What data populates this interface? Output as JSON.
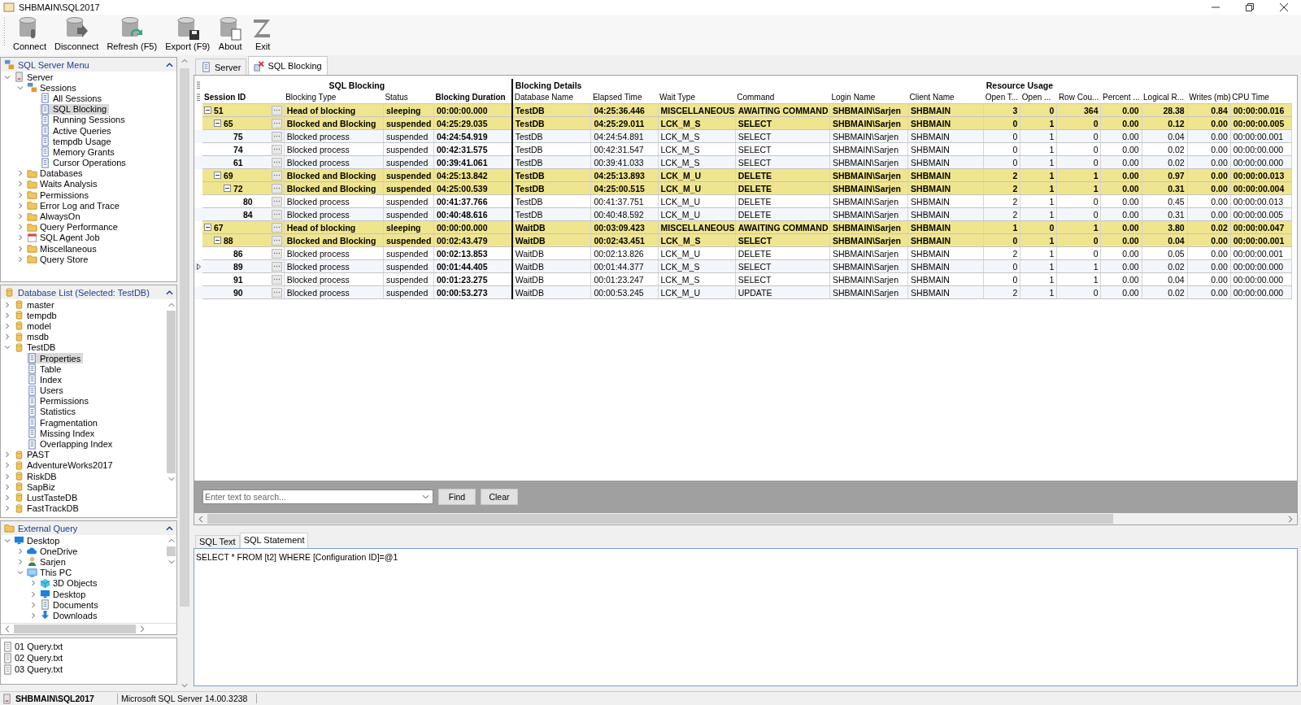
{
  "window": {
    "title": "SHBMAIN\\SQL2017"
  },
  "toolbar": [
    {
      "label": "Connect",
      "kind": "connect"
    },
    {
      "label": "Disconnect",
      "kind": "disconnect"
    },
    {
      "label": "Refresh (F5)",
      "kind": "refresh"
    },
    {
      "label": "Export (F9)",
      "kind": "export"
    },
    {
      "label": "About",
      "kind": "about"
    },
    {
      "label": "Exit",
      "kind": "exit"
    }
  ],
  "sidebar": {
    "panels": [
      {
        "title": "SQL Server Menu",
        "kind": "menu",
        "items": [
          {
            "label": "Server",
            "kind": "server",
            "expanded": true,
            "selected": false,
            "children": [
              {
                "label": "Sessions",
                "kind": "sessions",
                "expanded": true,
                "selected": false,
                "children": [
                  {
                    "label": "All Sessions",
                    "kind": "page",
                    "selected": false
                  },
                  {
                    "label": "SQL Blocking",
                    "kind": "page",
                    "selected": true
                  },
                  {
                    "label": "Running Sessions",
                    "kind": "page",
                    "selected": false
                  },
                  {
                    "label": "Active Queries",
                    "kind": "page",
                    "selected": false
                  },
                  {
                    "label": "tempdb Usage",
                    "kind": "page",
                    "selected": false
                  },
                  {
                    "label": "Memory Grants",
                    "kind": "page",
                    "selected": false
                  },
                  {
                    "label": "Cursor Operations",
                    "kind": "page",
                    "selected": false
                  }
                ]
              },
              {
                "label": "Databases",
                "kind": "folder",
                "expanded": false,
                "selected": false
              },
              {
                "label": "Waits Analysis",
                "kind": "folder",
                "expanded": false,
                "selected": false
              },
              {
                "label": "Permissions",
                "kind": "folder",
                "expanded": false,
                "selected": false
              },
              {
                "label": "Error Log and Trace",
                "kind": "folder",
                "expanded": false,
                "selected": false
              },
              {
                "label": "AlwaysOn",
                "kind": "folder",
                "expanded": false,
                "selected": false
              },
              {
                "label": "Query Performance",
                "kind": "folder",
                "expanded": false,
                "selected": false
              },
              {
                "label": "SQL Agent Job",
                "kind": "calendar",
                "expanded": false,
                "selected": false
              },
              {
                "label": "Miscellaneous",
                "kind": "folder",
                "expanded": false,
                "selected": false
              },
              {
                "label": "Query Store",
                "kind": "folder",
                "expanded": false,
                "selected": false
              }
            ]
          }
        ]
      },
      {
        "title": "Database List (Selected: TestDB)",
        "kind": "list",
        "items": [
          {
            "label": "master",
            "kind": "db",
            "expanded": false,
            "selected": false
          },
          {
            "label": "tempdb",
            "kind": "db",
            "expanded": false,
            "selected": false
          },
          {
            "label": "model",
            "kind": "db",
            "expanded": false,
            "selected": false
          },
          {
            "label": "msdb",
            "kind": "db",
            "expanded": false,
            "selected": false
          },
          {
            "label": "TestDB",
            "kind": "db",
            "expanded": true,
            "selected": false,
            "children": [
              {
                "label": "Properties",
                "kind": "page",
                "selected": true
              },
              {
                "label": "Table",
                "kind": "page",
                "selected": false
              },
              {
                "label": "Index",
                "kind": "page",
                "selected": false
              },
              {
                "label": "Users",
                "kind": "page",
                "selected": false
              },
              {
                "label": "Permissions",
                "kind": "page",
                "selected": false
              },
              {
                "label": "Statistics",
                "kind": "page",
                "selected": false
              },
              {
                "label": "Fragmentation",
                "kind": "page",
                "selected": false
              },
              {
                "label": "Missing Index",
                "kind": "page",
                "selected": false
              },
              {
                "label": "Overlapping Index",
                "kind": "page",
                "selected": false
              }
            ]
          },
          {
            "label": "PAST",
            "kind": "db",
            "expanded": false,
            "selected": false
          },
          {
            "label": "AdventureWorks2017",
            "kind": "db",
            "expanded": false,
            "selected": false
          },
          {
            "label": "RiskDB",
            "kind": "db",
            "expanded": false,
            "selected": false
          },
          {
            "label": "SapBiz",
            "kind": "db",
            "expanded": false,
            "selected": false
          },
          {
            "label": "LustTasteDB",
            "kind": "db",
            "expanded": false,
            "selected": false
          },
          {
            "label": "FastTrackDB",
            "kind": "db",
            "expanded": false,
            "selected": false
          }
        ]
      },
      {
        "title": "External Query",
        "kind": "explorer",
        "items": [
          {
            "label": "Desktop",
            "kind": "desktop",
            "expanded": true,
            "selected": false,
            "children": [
              {
                "label": "OneDrive",
                "kind": "cloud",
                "expanded": false,
                "selected": false
              },
              {
                "label": "Sarjen",
                "kind": "user",
                "expanded": false,
                "selected": false
              },
              {
                "label": "This PC",
                "kind": "pc",
                "expanded": true,
                "selected": false,
                "children": [
                  {
                    "label": "3D Objects",
                    "kind": "cube",
                    "expanded": false,
                    "selected": false
                  },
                  {
                    "label": "Desktop",
                    "kind": "desktop",
                    "expanded": false,
                    "selected": false
                  },
                  {
                    "label": "Documents",
                    "kind": "docs",
                    "expanded": false,
                    "selected": false
                  },
                  {
                    "label": "Downloads",
                    "kind": "download",
                    "expanded": false,
                    "selected": false
                  }
                ]
              }
            ]
          }
        ]
      }
    ],
    "files": [
      "01 Query.txt",
      "02 Query.txt",
      "03 Query.txt"
    ]
  },
  "tabs": [
    {
      "label": "Server",
      "kind": "server",
      "selected": false
    },
    {
      "label": "SQL Blocking",
      "kind": "blocking",
      "selected": true
    }
  ],
  "grid": {
    "column_groups": [
      "SQL Blocking",
      "Blocking Details",
      "Resource Usage"
    ],
    "columns": [
      {
        "label": "Session ID",
        "bold": true
      },
      {
        "label": "Blocking Type",
        "bold": false
      },
      {
        "label": "Status",
        "bold": false
      },
      {
        "label": "Blocking Duration",
        "bold": true
      },
      {
        "label": "Database Name",
        "bold": false
      },
      {
        "label": "Elapsed Time",
        "bold": false
      },
      {
        "label": "Wait Type",
        "bold": false
      },
      {
        "label": "Command",
        "bold": false
      },
      {
        "label": "Login Name",
        "bold": false
      },
      {
        "label": "Client Name",
        "bold": false
      },
      {
        "label": "Open T...",
        "bold": false
      },
      {
        "label": "Open ...",
        "bold": false
      },
      {
        "label": "Row Cou...",
        "bold": false
      },
      {
        "label": "Percent ...",
        "bold": false
      },
      {
        "label": "Logical R...",
        "bold": false
      },
      {
        "label": "Writes (mb)",
        "bold": false
      },
      {
        "label": "CPU Time",
        "bold": false
      }
    ],
    "rows": [
      {
        "kind": "blocking",
        "selected": false,
        "expanded": true,
        "cells": [
          "51",
          "Head of blocking",
          "sleeping",
          "00:00:00.000",
          "TestDB",
          "04:25:36.446",
          "MISCELLANEOUS",
          "AWAITING COMMAND",
          "SHBMAIN\\Sarjen",
          "SHBMAIN",
          "3",
          "0",
          "364",
          "0.00",
          "28.38",
          "0.84",
          "00:00:00.016"
        ],
        "children": [
          {
            "kind": "blocking",
            "selected": false,
            "expanded": true,
            "cells": [
              "65",
              "Blocked and Blocking",
              "suspended",
              "04:25:29.035",
              "TestDB",
              "04:25:29.011",
              "LCK_M_S",
              "SELECT",
              "SHBMAIN\\Sarjen",
              "SHBMAIN",
              "0",
              "1",
              "0",
              "0.00",
              "0.12",
              "0.00",
              "00:00:00.005"
            ],
            "children": [
              {
                "kind": "blocked",
                "selected": false,
                "cells": [
                  "75",
                  "Blocked process",
                  "suspended",
                  "04:24:54.919",
                  "TestDB",
                  "04:24:54.891",
                  "LCK_M_S",
                  "SELECT",
                  "SHBMAIN\\Sarjen",
                  "SHBMAIN",
                  "0",
                  "1",
                  "0",
                  "0.00",
                  "0.04",
                  "0.00",
                  "00:00:00.001"
                ]
              },
              {
                "kind": "blocked",
                "selected": false,
                "cells": [
                  "74",
                  "Blocked process",
                  "suspended",
                  "00:42:31.575",
                  "TestDB",
                  "00:42:31.547",
                  "LCK_M_S",
                  "SELECT",
                  "SHBMAIN\\Sarjen",
                  "SHBMAIN",
                  "0",
                  "1",
                  "0",
                  "0.00",
                  "0.02",
                  "0.00",
                  "00:00:00.000"
                ]
              },
              {
                "kind": "blocked",
                "selected": false,
                "cells": [
                  "61",
                  "Blocked process",
                  "suspended",
                  "00:39:41.061",
                  "TestDB",
                  "00:39:41.033",
                  "LCK_M_S",
                  "SELECT",
                  "SHBMAIN\\Sarjen",
                  "SHBMAIN",
                  "0",
                  "1",
                  "0",
                  "0.00",
                  "0.02",
                  "0.00",
                  "00:00:00.000"
                ]
              }
            ]
          },
          {
            "kind": "blocking",
            "selected": false,
            "expanded": true,
            "cells": [
              "69",
              "Blocked and Blocking",
              "suspended",
              "04:25:13.842",
              "TestDB",
              "04:25:13.893",
              "LCK_M_U",
              "DELETE",
              "SHBMAIN\\Sarjen",
              "SHBMAIN",
              "2",
              "1",
              "1",
              "0.00",
              "0.97",
              "0.00",
              "00:00:00.013"
            ],
            "children": [
              {
                "kind": "blocking",
                "selected": false,
                "expanded": true,
                "cells": [
                  "72",
                  "Blocked and Blocking",
                  "suspended",
                  "04:25:00.539",
                  "TestDB",
                  "04:25:00.515",
                  "LCK_M_U",
                  "DELETE",
                  "SHBMAIN\\Sarjen",
                  "SHBMAIN",
                  "2",
                  "1",
                  "1",
                  "0.00",
                  "0.31",
                  "0.00",
                  "00:00:00.004"
                ],
                "children": [
                  {
                    "kind": "blocked",
                    "selected": false,
                    "cells": [
                      "80",
                      "Blocked process",
                      "suspended",
                      "00:41:37.766",
                      "TestDB",
                      "00:41:37.751",
                      "LCK_M_U",
                      "DELETE",
                      "SHBMAIN\\Sarjen",
                      "SHBMAIN",
                      "2",
                      "1",
                      "0",
                      "0.00",
                      "0.45",
                      "0.00",
                      "00:00:00.013"
                    ]
                  },
                  {
                    "kind": "blocked",
                    "selected": false,
                    "cells": [
                      "84",
                      "Blocked process",
                      "suspended",
                      "00:40:48.616",
                      "TestDB",
                      "00:40:48.592",
                      "LCK_M_U",
                      "DELETE",
                      "SHBMAIN\\Sarjen",
                      "SHBMAIN",
                      "2",
                      "1",
                      "0",
                      "0.00",
                      "0.31",
                      "0.00",
                      "00:00:00.005"
                    ]
                  }
                ]
              }
            ]
          }
        ]
      },
      {
        "kind": "blocking",
        "selected": false,
        "expanded": true,
        "cells": [
          "67",
          "Head of blocking",
          "sleeping",
          "00:00:00.000",
          "WaitDB",
          "00:03:09.423",
          "MISCELLANEOUS",
          "AWAITING COMMAND",
          "SHBMAIN\\Sarjen",
          "SHBMAIN",
          "1",
          "0",
          "1",
          "0.00",
          "3.80",
          "0.02",
          "00:00:00.047"
        ],
        "children": [
          {
            "kind": "blocking",
            "selected": false,
            "expanded": true,
            "cells": [
              "88",
              "Blocked and Blocking",
              "suspended",
              "00:02:43.479",
              "WaitDB",
              "00:02:43.451",
              "LCK_M_S",
              "SELECT",
              "SHBMAIN\\Sarjen",
              "SHBMAIN",
              "0",
              "1",
              "0",
              "0.00",
              "0.04",
              "0.00",
              "00:00:00.001"
            ],
            "children": [
              {
                "kind": "blocked",
                "selected": false,
                "cells": [
                  "86",
                  "Blocked process",
                  "suspended",
                  "00:02:13.853",
                  "WaitDB",
                  "00:02:13.826",
                  "LCK_M_U",
                  "DELETE",
                  "SHBMAIN\\Sarjen",
                  "SHBMAIN",
                  "2",
                  "1",
                  "0",
                  "0.00",
                  "0.05",
                  "0.00",
                  "00:00:00.001"
                ]
              },
              {
                "kind": "blocked",
                "selected": true,
                "cells": [
                  "89",
                  "Blocked process",
                  "suspended",
                  "00:01:44.405",
                  "WaitDB",
                  "00:01:44.377",
                  "LCK_M_S",
                  "SELECT",
                  "SHBMAIN\\Sarjen",
                  "SHBMAIN",
                  "0",
                  "1",
                  "1",
                  "0.00",
                  "0.02",
                  "0.00",
                  "00:00:00.000"
                ]
              },
              {
                "kind": "blocked",
                "selected": false,
                "cells": [
                  "91",
                  "Blocked process",
                  "suspended",
                  "00:01:23.275",
                  "WaitDB",
                  "00:01:23.247",
                  "LCK_M_S",
                  "SELECT",
                  "SHBMAIN\\Sarjen",
                  "SHBMAIN",
                  "0",
                  "1",
                  "1",
                  "0.00",
                  "0.04",
                  "0.00",
                  "00:00:00.000"
                ]
              },
              {
                "kind": "blocked",
                "selected": false,
                "cells": [
                  "90",
                  "Blocked process",
                  "suspended",
                  "00:00:53.273",
                  "WaitDB",
                  "00:00:53.245",
                  "LCK_M_U",
                  "UPDATE",
                  "SHBMAIN\\Sarjen",
                  "SHBMAIN",
                  "2",
                  "1",
                  "0",
                  "0.00",
                  "0.02",
                  "0.00",
                  "00:00:00.000"
                ]
              }
            ]
          }
        ]
      }
    ]
  },
  "search": {
    "placeholder": "Enter text to search...",
    "buttons": [
      "Find",
      "Clear"
    ]
  },
  "bottom_tabs": [
    {
      "label": "SQL Text",
      "selected": false
    },
    {
      "label": "SQL Statement",
      "selected": true
    }
  ],
  "sql_text": "SELECT * FROM [t2] WHERE [Configuration ID]=@1",
  "status_bar": {
    "server": "SHBMAIN\\SQL2017",
    "version": "Microsoft SQL Server 14.00.3238"
  }
}
